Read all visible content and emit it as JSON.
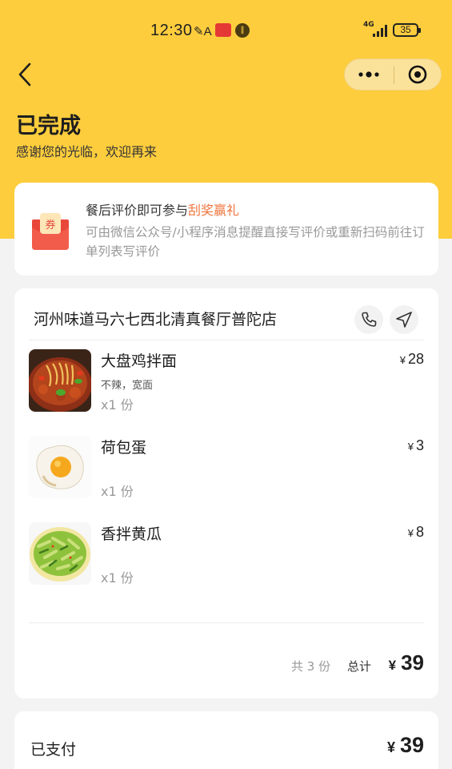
{
  "status_bar": {
    "time": "12:30",
    "network": "4G",
    "battery": "35"
  },
  "header": {
    "title": "已完成",
    "subtitle": "感谢您的光临，欢迎再来"
  },
  "promo": {
    "icon_text": "券",
    "text_prefix": "餐后评价即可参与",
    "text_highlight": "刮奖赢礼",
    "description": "可由微信公众号/小程序消息提醒直接写评价或重新扫码前往订单列表写评价"
  },
  "order": {
    "shop_name": "河州味道马六七西北清真餐厅普陀店",
    "items": [
      {
        "name": "大盘鸡拌面",
        "spec": "不辣，宽面",
        "qty": "x1 份",
        "currency": "¥",
        "price": "28"
      },
      {
        "name": "荷包蛋",
        "spec": "",
        "qty": "x1 份",
        "currency": "¥",
        "price": "3"
      },
      {
        "name": "香拌黄瓜",
        "spec": "",
        "qty": "x1 份",
        "currency": "¥",
        "price": "8"
      }
    ],
    "summary": {
      "count": "共 3 份",
      "total_label": "总计",
      "currency": "¥",
      "total": "39"
    }
  },
  "payment": {
    "label": "已支付",
    "currency": "¥",
    "amount": "39"
  },
  "colors": {
    "brand_yellow": "#fdcd3d",
    "highlight_orange": "#f0753e"
  }
}
